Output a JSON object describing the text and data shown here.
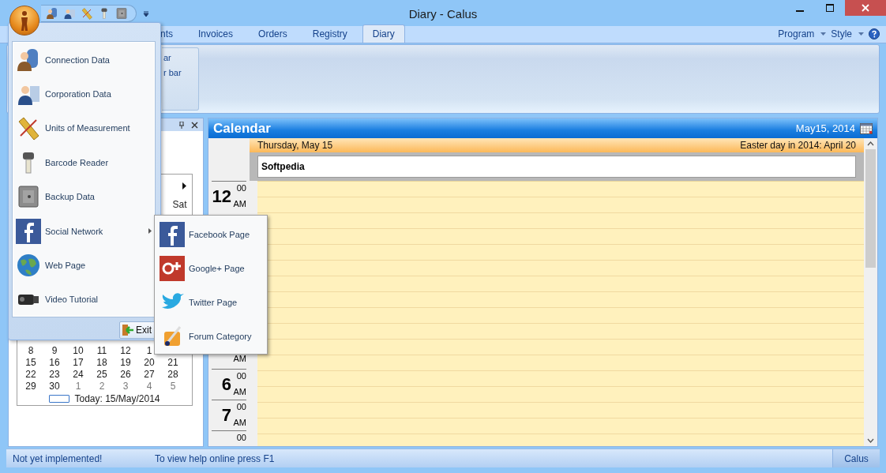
{
  "window": {
    "title": "Diary - Calus"
  },
  "ribbon": {
    "tabs": [
      {
        "label": "nts",
        "selected": false
      },
      {
        "label": "Invoices",
        "selected": false
      },
      {
        "label": "Orders",
        "selected": false
      },
      {
        "label": "Registry",
        "selected": false
      },
      {
        "label": "Diary",
        "selected": true
      }
    ],
    "right_menus": [
      "Program",
      "Style"
    ],
    "group_items": [
      "ar",
      "r bar"
    ]
  },
  "mini_calendar": {
    "day_names": [
      "Sat"
    ],
    "weeks": [
      [
        {
          "day": "8",
          "other_month": false
        },
        {
          "day": "9",
          "other_month": false
        },
        {
          "day": "10",
          "other_month": false
        },
        {
          "day": "11",
          "other_month": false
        },
        {
          "day": "12",
          "other_month": false
        },
        {
          "day": "1",
          "other_month": false
        }
      ],
      [
        {
          "day": "15",
          "other_month": false
        },
        {
          "day": "16",
          "other_month": false
        },
        {
          "day": "17",
          "other_month": false
        },
        {
          "day": "18",
          "other_month": false
        },
        {
          "day": "19",
          "other_month": false
        },
        {
          "day": "20",
          "other_month": false
        },
        {
          "day": "21",
          "other_month": false
        }
      ],
      [
        {
          "day": "22",
          "other_month": false
        },
        {
          "day": "23",
          "other_month": false
        },
        {
          "day": "24",
          "other_month": false
        },
        {
          "day": "25",
          "other_month": false
        },
        {
          "day": "26",
          "other_month": false
        },
        {
          "day": "27",
          "other_month": false
        },
        {
          "day": "28",
          "other_month": false
        }
      ],
      [
        {
          "day": "29",
          "other_month": false
        },
        {
          "day": "30",
          "other_month": false
        },
        {
          "day": "1",
          "other_month": true
        },
        {
          "day": "2",
          "other_month": true
        },
        {
          "day": "3",
          "other_month": true
        },
        {
          "day": "4",
          "other_month": true
        },
        {
          "day": "5",
          "other_month": true
        }
      ]
    ],
    "today": "Today: 15/May/2014"
  },
  "calendar": {
    "title": "Calendar",
    "date": "May15, 2014",
    "day_header": "Thursday, May 15",
    "holiday_note": "Easter day in 2014: April 20",
    "all_day_events": [
      "Softpedia"
    ],
    "time_slots": [
      {
        "hour": "12",
        "minutes": "00",
        "period": "AM"
      },
      {
        "period": "AM"
      },
      {
        "hour": "6",
        "minutes": "00",
        "period": "AM"
      },
      {
        "hour": "7",
        "minutes": "00",
        "period": "AM"
      },
      {
        "minutes": "00"
      }
    ]
  },
  "status_bar": {
    "message": "Not yet implemented!",
    "help": "To view help online press F1",
    "app": "Calus"
  },
  "app_menu": {
    "items": [
      {
        "label": "Connection Data",
        "has_submenu": false
      },
      {
        "label": "Corporation Data",
        "has_submenu": false
      },
      {
        "label": "Units of Measurement",
        "has_submenu": false
      },
      {
        "label": "Barcode Reader",
        "has_submenu": false
      },
      {
        "label": "Backup Data",
        "has_submenu": false
      },
      {
        "label": "Social Network",
        "has_submenu": true
      },
      {
        "label": "Web Page",
        "has_submenu": false
      },
      {
        "label": "Video Tutorial",
        "has_submenu": false
      }
    ],
    "exit": "Exit"
  },
  "submenu": {
    "items": [
      "Facebook Page",
      "Google+ Page",
      "Twitter Page",
      "Forum Category"
    ]
  }
}
